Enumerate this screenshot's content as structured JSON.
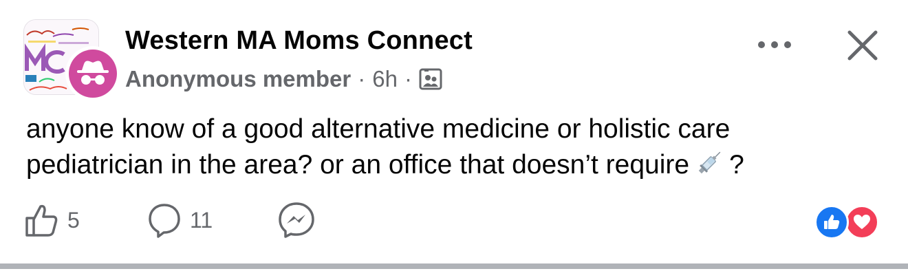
{
  "post": {
    "group_name": "Western MA Moms Connect",
    "author": "Anonymous member",
    "separator": "·",
    "time": "6h",
    "audience_icon": "group-members-icon",
    "text_line1": "anyone know of a good alternative medicine or holistic care",
    "text_line2": "pediatrician in the area? or an office that doesn’t require",
    "text_emoji": "syringe-emoji",
    "text_end": "?",
    "more_icon": "more-options-icon",
    "close_icon": "close-icon"
  },
  "actions": {
    "like_icon": "thumbs-up-icon",
    "like_count": "5",
    "comment_icon": "comment-bubble-icon",
    "comment_count": "11",
    "share_icon": "messenger-icon"
  },
  "reactions": [
    "like",
    "love"
  ],
  "colors": {
    "anonymous_avatar": "#d04a9e",
    "like_reaction": "#1877f2",
    "love_reaction": "#f33e58",
    "secondary_text": "#65676b",
    "divider": "#b0b3b8"
  }
}
